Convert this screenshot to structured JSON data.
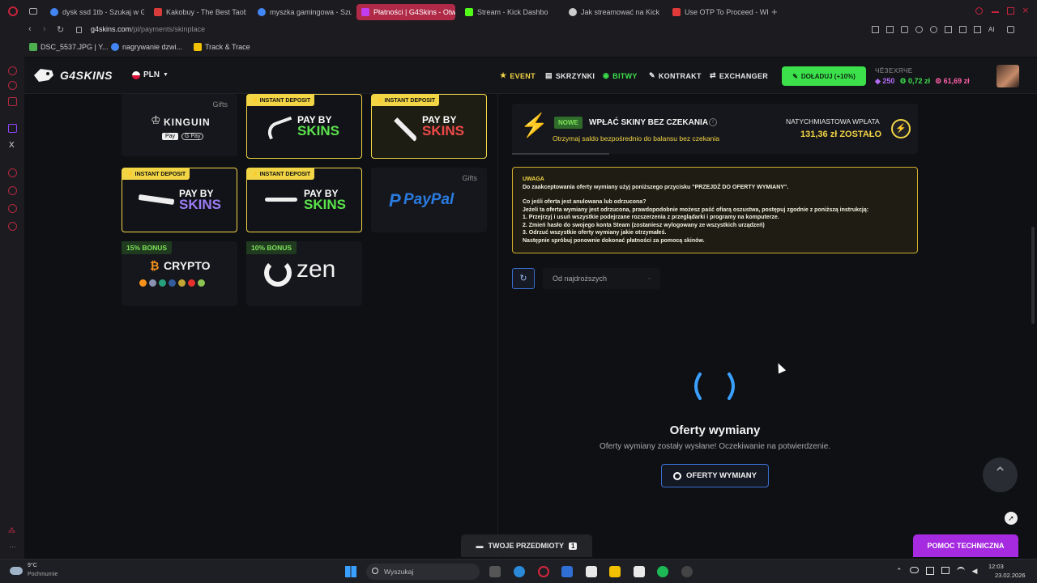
{
  "browser": {
    "tabs": [
      {
        "label": "dysk ssd 1tb - Szukaj w Go",
        "color": "#4285f4"
      },
      {
        "label": "Kakobuy - The Best Taob",
        "color": "#d93a3a"
      },
      {
        "label": "myszka gamingowa - Szuk",
        "color": "#4285f4"
      },
      {
        "label": "Płatności | G4Skins - Otw",
        "color": "#c23cf0"
      },
      {
        "label": "Stream - Kick Dashbo",
        "color": "#53fc18"
      },
      {
        "label": "Jak streamować na Kick",
        "color": "#cccccc"
      },
      {
        "label": "Use OTP To Proceed - WP",
        "color": "#e03a3a"
      }
    ],
    "url_host": "g4skins.com",
    "url_path": "/pl/payments/skinplace",
    "bookmarks": [
      "DSC_5537.JPG | Y...",
      "nagrywanie dzwi...",
      "Track & Trace"
    ]
  },
  "header": {
    "logo": "G4SKINS",
    "currency": "PLN",
    "nav": [
      "EVENT",
      "SKRZYNKI",
      "BITWY",
      "KONTRAKT",
      "EXCHANGER"
    ],
    "topup_label": "DOŁADUJ (+10%)",
    "user_name": "ЧЁЗЕХЯЧЕ",
    "gems": "250",
    "balance_green": "0,72 zł",
    "balance_pink": "61,69 zł"
  },
  "payments": {
    "kinguin": {
      "name": "KINGUIN",
      "tag": "Gifts",
      "pay1": "Pay",
      "pay2": "G Pay"
    },
    "instant_badge": "INSTANT DEPOSIT",
    "pay_top": "PAY BY",
    "pay_bottom": "SKINS",
    "paypal": {
      "name": "PayPal",
      "tag": "Gifts"
    },
    "crypto": {
      "badge": "15% BONUS",
      "name": "CRYPTO"
    },
    "zen": {
      "badge": "10% BONUS",
      "name": "zen"
    }
  },
  "promo": {
    "badge": "NOWE",
    "title": "WPŁAĆ SKINY BEZ CZEKANIA",
    "subtitle": "Otrzymaj saldo bezpośrednio do balansu bez czekania",
    "right_label": "NATYCHMIASTOWA WPŁATA",
    "right_value": "131,36 zł ZOSTAŁO"
  },
  "warning": {
    "title": "UWAGA",
    "line1": "Do zaakceptowania oferty wymiany użyj poniższego przycisku \"PRZEJDŹ DO OFERTY WYMIANY\".",
    "line2": "Co jeśli oferta jest anulowana lub odrzucona?",
    "line3": "Jeżeli ta oferta wymiany jest odrzucona, prawdopodobnie możesz paść ofiarą oszustwa, postępuj zgodnie z poniższą instrukcją:",
    "line4": "1. Przejrzyj i usuń wszystkie podejrzane rozszerzenia z przeglądarki i programy na komputerze.",
    "line5": "2. Zmień hasło do swojego konta Steam (zostaniesz wylogowany ze wszystkich urządzeń)",
    "line6": "3. Odrzuć wszystkie oferty wymiany jakie otrzymałeś.",
    "line7": "Następnie spróbuj ponownie dokonać płatności za pomocą skinów."
  },
  "sort": {
    "label": "Od najdroższych"
  },
  "offers": {
    "title": "Oferty wymiany",
    "subtitle": "Oferty wymiany zostały wysłane! Oczekiwanie na potwierdzenie.",
    "button": "OFERTY WYMIANY"
  },
  "bottom": {
    "items_label": "TWOJE PRZEDMIOTY",
    "items_count": "1",
    "support_label": "POMOC TECHNICZNA"
  },
  "taskbar": {
    "weather_temp": "9°C",
    "weather_desc": "Pochmurnie",
    "search_placeholder": "Wyszukaj",
    "time": "12:03",
    "date": "23.02.2026"
  },
  "colors": {
    "accent_green": "#3be04b",
    "accent_yellow": "#f2d545",
    "accent_purple": "#a52ae0",
    "brand_red": "#b02a47"
  }
}
